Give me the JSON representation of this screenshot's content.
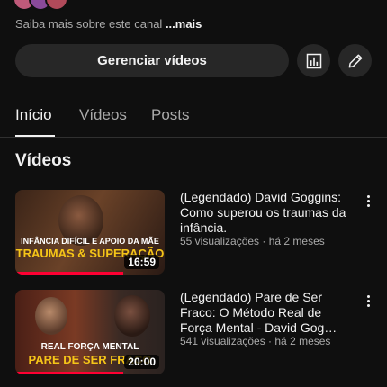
{
  "channel": {
    "about_prefix": "Saiba mais sobre este canal ",
    "about_more": "...mais"
  },
  "actions": {
    "manage_label": "Gerenciar vídeos",
    "analytics_icon": "bar-chart-icon",
    "edit_icon": "pencil-icon"
  },
  "tabs": [
    {
      "label": "Início",
      "active": true
    },
    {
      "label": "Vídeos",
      "active": false
    },
    {
      "label": "Posts",
      "active": false
    }
  ],
  "section": {
    "title": "Vídeos"
  },
  "videos": [
    {
      "title": "(Legendado) David Goggins: Como superou os traumas da infância.",
      "meta": "55 visualizações · há 2 meses",
      "duration": "16:59",
      "thumb_caption_top": "INFÂNCIA DIFÍCIL E APOIO DA MÃE",
      "thumb_caption_bottom": "TRAUMAS & SUPERAÇÃO",
      "watched_fraction": 0.72
    },
    {
      "title": "(Legendado) Pare de Ser Fraco: O Método Real de Força Mental - David Gog…",
      "meta": "541 visualizações · há 2 meses",
      "duration": "20:00",
      "thumb_caption_top": "REAL FORÇA MENTAL",
      "thumb_caption_bottom": "PARE DE SER FRACO",
      "watched_fraction": 0.72
    }
  ],
  "colors": {
    "background": "#0f0f0f",
    "accent": "#ff0033",
    "secondary_text": "#aaaaaa"
  }
}
